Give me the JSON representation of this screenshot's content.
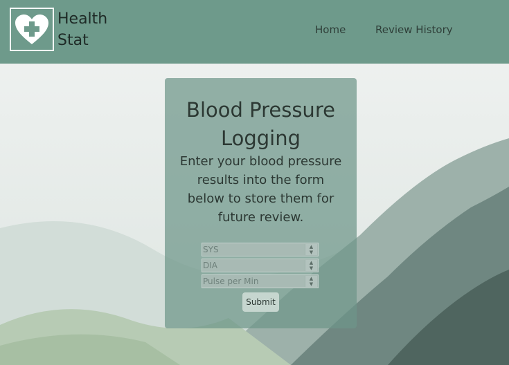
{
  "header": {
    "brand_line1": "Health",
    "brand_line2": "Stat",
    "logo_icon": "heart-plus-icon",
    "nav": {
      "home": "Home",
      "review_history": "Review History"
    }
  },
  "form": {
    "title": "Blood Pressure Logging",
    "description": "Enter your blood pressure results into the form below to store them for future review.",
    "fields": {
      "sys_placeholder": "SYS",
      "dia_placeholder": "DIA",
      "pulse_placeholder": "Pulse per Min"
    },
    "submit_label": "Submit"
  },
  "colors": {
    "header_bg": "#6e9a8b",
    "card_bg": "#6e9689",
    "text": "#2c3833"
  }
}
